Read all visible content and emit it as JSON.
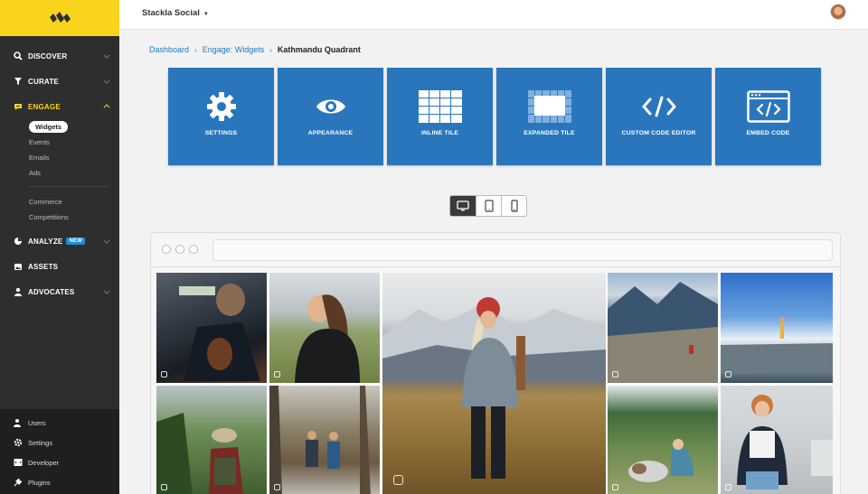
{
  "header": {
    "workspace_name": "Stackla Social",
    "workspace_caret": "▼"
  },
  "sidebar": {
    "nav": [
      {
        "label": "DISCOVER",
        "icon": "search-icon"
      },
      {
        "label": "CURATE",
        "icon": "filter-icon"
      },
      {
        "label": "ENGAGE",
        "icon": "chat-icon"
      }
    ],
    "engage_sub": [
      "Widgets",
      "Events",
      "Emails",
      "Ads"
    ],
    "engage_sub2": [
      "Commerce",
      "Competitions"
    ],
    "nav2": [
      {
        "label": "ANALYZE",
        "icon": "pie-chart-icon",
        "badge": "NEW"
      },
      {
        "label": "ASSETS",
        "icon": "images-icon"
      },
      {
        "label": "ADVOCATES",
        "icon": "user-icon"
      }
    ],
    "bottom": [
      {
        "label": "Users",
        "icon": "users-icon"
      },
      {
        "label": "Settings",
        "icon": "gear-icon"
      },
      {
        "label": "Developer",
        "icon": "code-icon"
      },
      {
        "label": "Plugins",
        "icon": "plug-icon"
      }
    ],
    "accent_color": "#f8d51c"
  },
  "breadcrumb": {
    "items": [
      "Dashboard",
      "Engage: Widgets"
    ],
    "separator": "›",
    "current": "Kathmandu Quadrant"
  },
  "tiles": [
    {
      "label": "SETTINGS",
      "icon": "gear-icon"
    },
    {
      "label": "APPEARANCE",
      "icon": "eye-icon"
    },
    {
      "label": "INLINE TILE",
      "icon": "grid-icon"
    },
    {
      "label": "EXPANDED TILE",
      "icon": "expanded-tile-icon"
    },
    {
      "label": "CUSTOM CODE EDITOR",
      "icon": "code-icon"
    },
    {
      "label": "EMBED CODE",
      "icon": "embed-code-icon"
    }
  ],
  "tile_color": "#2a76bd",
  "devices": [
    {
      "name": "desktop",
      "icon": "desktop-icon",
      "active": true
    },
    {
      "name": "tablet",
      "icon": "tablet-icon",
      "active": false
    },
    {
      "name": "mobile",
      "icon": "mobile-icon",
      "active": false
    }
  ]
}
